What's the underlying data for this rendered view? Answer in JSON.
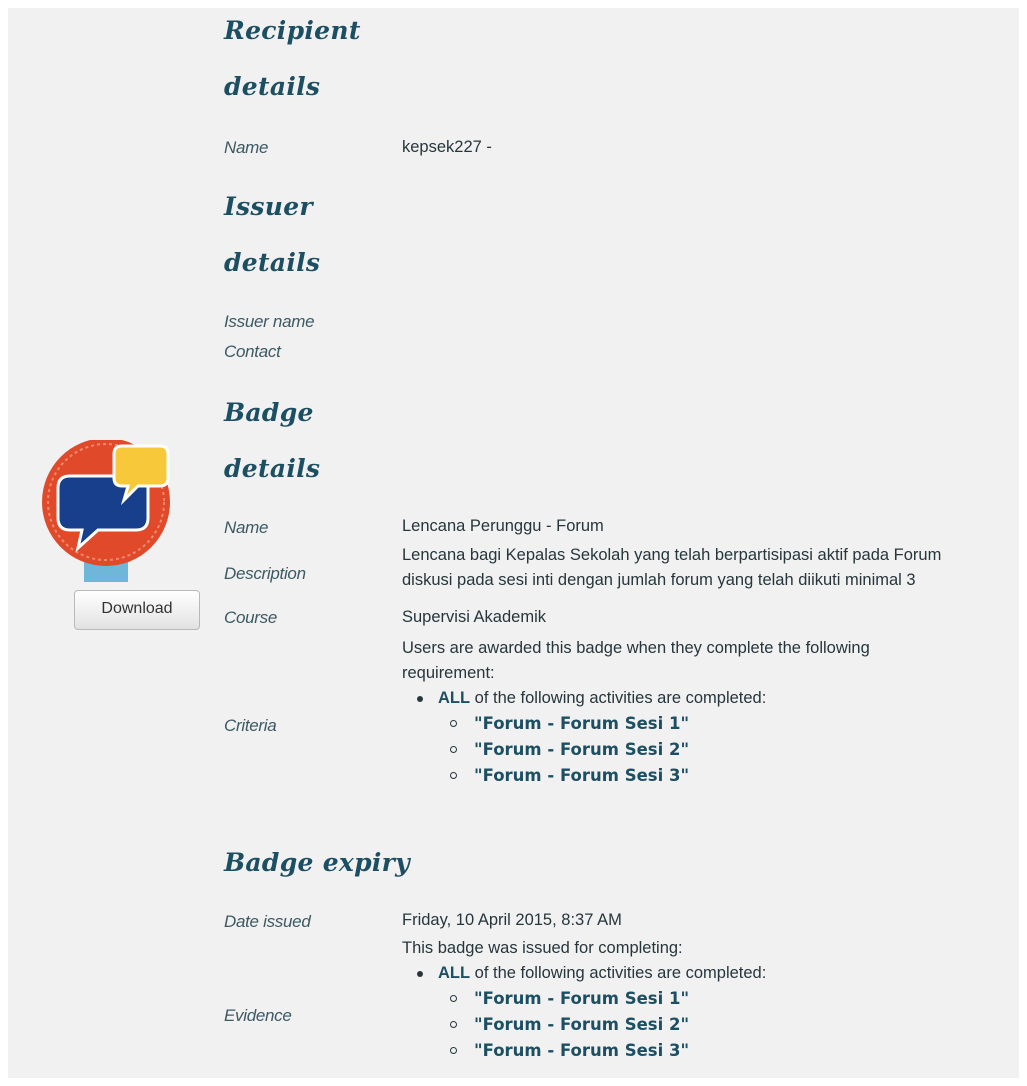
{
  "recipient": {
    "heading_line1": "Recipient",
    "heading_line2": "details",
    "name_label": "Name",
    "name_value": "kepsek227 -"
  },
  "issuer": {
    "heading_line1": "Issuer",
    "heading_line2": "details",
    "issuer_name_label": "Issuer name",
    "contact_label": "Contact"
  },
  "badge": {
    "heading_line1": "Badge",
    "heading_line2": "details",
    "download_label": "Download",
    "name_label": "Name",
    "name_value": "Lencana Perunggu - Forum",
    "description_label": "Description",
    "description_line1": "Lencana bagi Kepalas Sekolah yang telah berpartisipasi aktif pada Forum",
    "description_line2": "diskusi pada sesi inti dengan jumlah forum yang telah diikuti minimal 3",
    "course_label": "Course",
    "course_value": "Supervisi Akademik",
    "criteria_label": "Criteria",
    "criteria_intro_line1": "Users are awarded this badge when they complete the following",
    "criteria_intro_line2": "requirement:",
    "criteria_all": "ALL",
    "criteria_all_rest": " of the following activities are completed:",
    "criteria_items": [
      "\"Forum - Forum Sesi 1\"",
      "\"Forum - Forum Sesi 2\"",
      "\"Forum - Forum Sesi 3\""
    ],
    "colors": {
      "ring": "#e04a2b",
      "bubble_blue": "#173f8c",
      "bubble_yellow": "#f7c93a",
      "ribbon": "#6fb7d9"
    }
  },
  "expiry": {
    "heading": "Badge expiry",
    "date_issued_label": "Date issued",
    "date_issued_value": "Friday, 10 April 2015, 8:37 AM",
    "evidence_label": "Evidence",
    "evidence_intro": "This badge was issued for completing:",
    "evidence_all": "ALL",
    "evidence_all_rest": " of the following activities are completed:",
    "evidence_items": [
      "\"Forum - Forum Sesi 1\"",
      "\"Forum - Forum Sesi 2\"",
      "\"Forum - Forum Sesi 3\""
    ]
  }
}
